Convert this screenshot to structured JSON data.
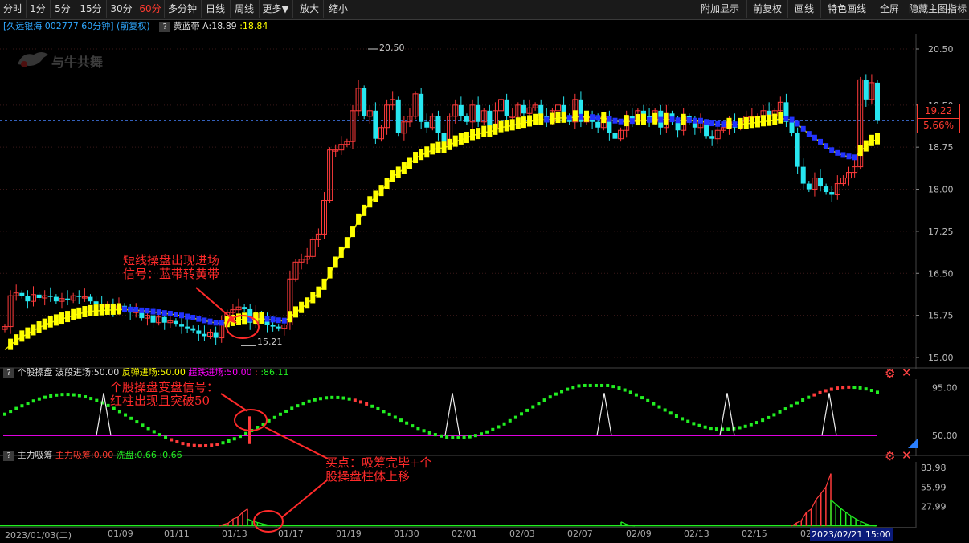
{
  "toolbar": {
    "left": [
      "分时",
      "1分",
      "5分",
      "15分",
      "30分",
      "60分",
      "多分钟",
      "日线",
      "周线",
      "更多▼",
      "放大",
      "缩小"
    ],
    "right": [
      "附加显示",
      "前复权",
      "画线",
      "特色画线",
      "全屏",
      "隐藏主图指标"
    ],
    "active": "60分"
  },
  "main": {
    "title": "[久远银海 002777 60分钟] (前复权)",
    "indicator_name": "黄蓝带",
    "ind_a_label": "A:18.89",
    "ind_b_label": ":18.84",
    "watermark": "与牛共舞",
    "price_label": "19.22",
    "pct_label": "5.66%",
    "high_label": "20.50",
    "low_label": "15.21"
  },
  "ind1": {
    "name": "个股操盘",
    "l1": "波段进场:50.00",
    "l2": "反弹进场:50.00",
    "l3": "超跌进场:50.00",
    "l4": ":",
    "l5": ":86.11"
  },
  "ind2": {
    "name": "主力吸筹",
    "l1": "主力吸筹:0.00",
    "l2": "洗盘:0.66",
    "l3": ":0.66"
  },
  "annotations": {
    "a1_line1": "短线操盘出现进场",
    "a1_line2": "信号：蓝带转黄带",
    "a2_line1": "个股操盘变盘信号：",
    "a2_line2": "红柱出现且突破50",
    "a3_line1": "买点：吸筹完毕+个",
    "a3_line2": "股操盘柱体上移"
  },
  "xaxis": {
    "dates": [
      "2023/01/03(二)",
      "01/09",
      "01/11",
      "01/13",
      "01/17",
      "01/19",
      "01/30",
      "02/01",
      "02/03",
      "02/07",
      "02/09",
      "02/13",
      "02/15",
      "02/17"
    ],
    "cursor_label": "2023/02/21 15:00"
  },
  "colors": {
    "up": "#ff3b3b",
    "down": "#27e6f0",
    "yellow_band": "#ffff00",
    "blue_band": "#2233ff",
    "magenta": "#ff00ff",
    "green": "#22ee22",
    "grid": "#3a1818"
  },
  "chart_data": [
    {
      "type": "candlestick",
      "title": "久远银海 002777 60分钟",
      "y_ticks": [
        15.0,
        15.75,
        16.5,
        17.25,
        18.0,
        18.75,
        19.5,
        20.5
      ],
      "ylim": [
        15.0,
        20.5
      ],
      "series": [
        {
          "name": "close",
          "values": [
            15.55,
            16.1,
            16.15,
            16.1,
            16.0,
            16.12,
            16.06,
            16.1,
            16.08,
            16.0,
            16.05,
            16.02,
            16.1,
            16.08,
            16.08,
            16.0,
            15.95,
            15.9,
            15.95,
            15.85,
            15.92,
            15.85,
            15.8,
            15.82,
            15.7,
            15.75,
            15.62,
            15.72,
            15.62,
            15.65,
            15.6,
            15.55,
            15.52,
            15.48,
            15.42,
            15.38,
            15.45,
            15.35,
            15.6,
            15.8,
            15.85,
            15.9,
            15.86,
            15.62,
            15.78,
            15.7,
            15.58,
            15.55,
            15.52,
            15.58,
            16.4,
            16.7,
            16.75,
            16.8,
            17.1,
            17.2,
            17.8,
            18.7,
            18.7,
            18.8,
            18.85,
            19.4,
            19.8,
            19.3,
            19.4,
            18.9,
            19.1,
            19.5,
            19.6,
            19.0,
            19.2,
            19.3,
            19.7,
            19.2,
            19.1,
            19.3,
            19.0,
            18.8,
            19.3,
            19.5,
            19.3,
            19.2,
            19.5,
            19.2,
            19.4,
            19.1,
            19.4,
            19.6,
            19.3,
            19.3,
            19.5,
            19.35,
            19.45,
            19.5,
            19.3,
            19.2,
            19.4,
            19.5,
            19.3,
            19.2,
            19.6,
            19.2,
            19.3,
            19.2,
            19.1,
            19.3,
            19.0,
            18.9,
            19.05,
            19.3,
            19.2,
            19.4,
            19.3,
            19.2,
            19.4,
            19.1,
            19.35,
            19.2,
            19.05,
            19.3,
            19.2,
            19.1,
            19.2,
            18.95,
            18.9,
            19.05,
            19.1,
            19.2,
            19.1,
            19.2,
            19.3,
            19.3,
            19.3,
            19.4,
            19.3,
            19.4,
            19.55,
            19.2,
            19.0,
            18.4,
            18.1,
            18.0,
            18.2,
            18.05,
            17.95,
            17.9,
            18.1,
            18.2,
            18.3,
            18.4,
            19.95,
            19.6,
            19.9,
            19.22
          ]
        }
      ]
    },
    {
      "type": "bar",
      "title": "个股操盘",
      "y_ticks": [
        50.0,
        95.0
      ],
      "ylim": [
        35,
        100
      ],
      "series": [
        {
          "name": "波段进场",
          "values": [
            50.0
          ]
        },
        {
          "name": "value",
          "values": [
            86.11
          ]
        }
      ]
    },
    {
      "type": "bar",
      "title": "主力吸筹",
      "y_ticks": [
        27.99,
        55.99,
        83.98
      ],
      "ylim": [
        0,
        90
      ],
      "series": [
        {
          "name": "主力吸筹",
          "values": [
            0.0
          ]
        },
        {
          "name": "洗盘",
          "values": [
            0.66
          ]
        }
      ]
    }
  ]
}
